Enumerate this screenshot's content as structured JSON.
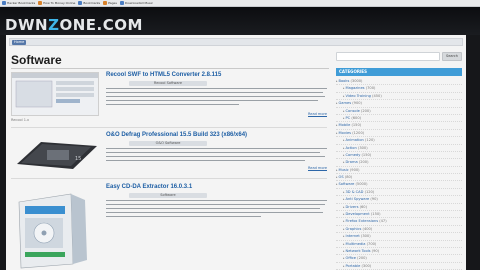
{
  "bookmarks": [
    {
      "label": "Hacker Bookmarks",
      "color": "#4a7cc2"
    },
    {
      "label": "How To Money Online",
      "color": "#d9822b"
    },
    {
      "label": "Bookmarks",
      "color": "#4a7cc2"
    },
    {
      "label": "Pages",
      "color": "#d9822b"
    },
    {
      "label": "DownloadAll Music",
      "color": "#4a7cc2"
    }
  ],
  "site": {
    "logo_prefix": "DWN",
    "logo_o": "Z",
    "logo_suffix": "ONE.COM"
  },
  "breadcrumb": {
    "home": "Home"
  },
  "main": {
    "title": "Software"
  },
  "posts": [
    {
      "title": "Recool SWF to HTML5 Converter 2.8.115",
      "meta": "Recool Software",
      "read_more": "Read more",
      "thumb_caption": "Recool 1.x"
    },
    {
      "title": "O&O Defrag Professional 15.5 Build 323 (x86/x64)",
      "meta": "O&O Software",
      "read_more": "Read more",
      "thumb_caption": ""
    },
    {
      "title": "Easy CD-DA Extractor 16.0.3.1",
      "meta": "Software",
      "read_more": "Read more",
      "thumb_caption": ""
    }
  ],
  "sidebar": {
    "search_button": "Search",
    "categories_title": "CATEGORIES",
    "categories": [
      {
        "label": "Books",
        "count": "(3000)",
        "sub": false
      },
      {
        "label": "Magazines",
        "count": "(700)",
        "sub": true
      },
      {
        "label": "Video Training",
        "count": "(450)",
        "sub": true
      },
      {
        "label": "Games",
        "count": "(900)",
        "sub": false
      },
      {
        "label": "Console",
        "count": "(200)",
        "sub": true
      },
      {
        "label": "PC",
        "count": "(600)",
        "sub": true
      },
      {
        "label": "Mobile",
        "count": "(150)",
        "sub": false
      },
      {
        "label": "Movies",
        "count": "(1200)",
        "sub": false
      },
      {
        "label": "Animation",
        "count": "(120)",
        "sub": true
      },
      {
        "label": "Action",
        "count": "(300)",
        "sub": true
      },
      {
        "label": "Comedy",
        "count": "(150)",
        "sub": true
      },
      {
        "label": "Drama",
        "count": "(200)",
        "sub": true
      },
      {
        "label": "Music",
        "count": "(900)",
        "sub": false
      },
      {
        "label": "OS",
        "count": "(80)",
        "sub": false
      },
      {
        "label": "Software",
        "count": "(5000)",
        "sub": false
      },
      {
        "label": "3D & CAD",
        "count": "(120)",
        "sub": true
      },
      {
        "label": "Anti Spyware",
        "count": "(90)",
        "sub": true
      },
      {
        "label": "Drivers",
        "count": "(60)",
        "sub": true
      },
      {
        "label": "Development",
        "count": "(150)",
        "sub": true
      },
      {
        "label": "Firefox Extensions",
        "count": "(47)",
        "sub": true
      },
      {
        "label": "Graphics",
        "count": "(400)",
        "sub": true
      },
      {
        "label": "Internet",
        "count": "(300)",
        "sub": true
      },
      {
        "label": "Multimedia",
        "count": "(700)",
        "sub": true
      },
      {
        "label": "Network Tools",
        "count": "(90)",
        "sub": true
      },
      {
        "label": "Office",
        "count": "(200)",
        "sub": true
      },
      {
        "label": "Portable",
        "count": "(300)",
        "sub": true
      },
      {
        "label": "Programming",
        "count": "(80)",
        "sub": true
      }
    ]
  }
}
